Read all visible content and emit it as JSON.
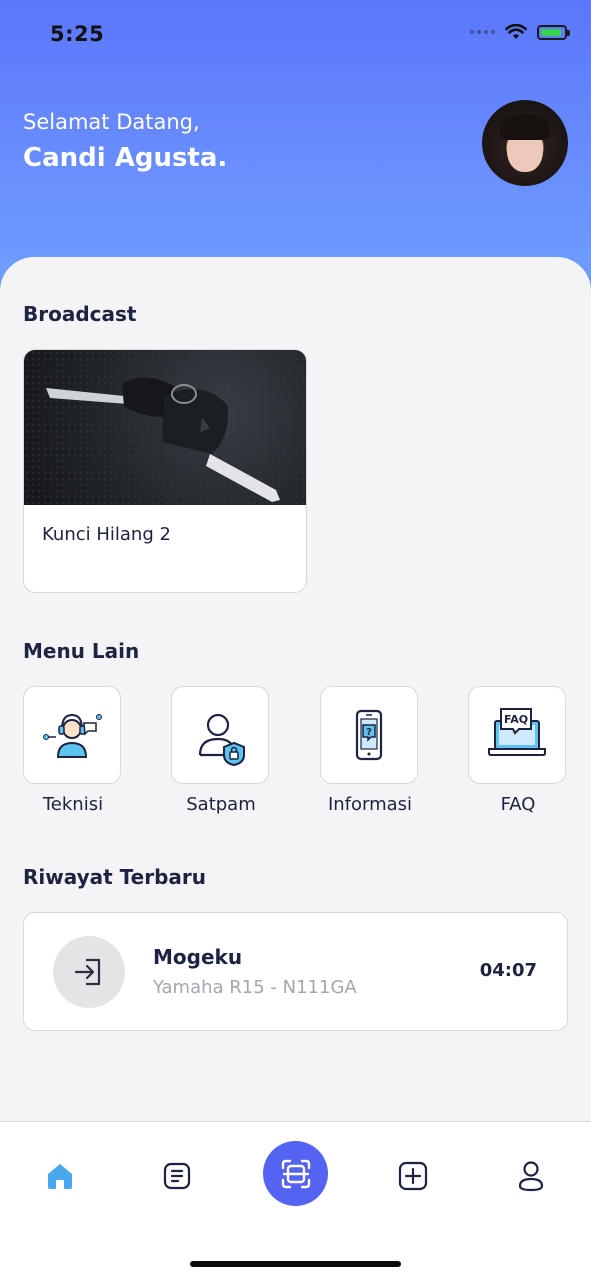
{
  "status_bar": {
    "time": "5:25"
  },
  "header": {
    "greeting": "Selamat Datang,",
    "user_name": "Candi Agusta."
  },
  "broadcast": {
    "title": "Broadcast",
    "items": [
      {
        "title": "Kunci Hilang 2"
      }
    ]
  },
  "menu_lain": {
    "title": "Menu Lain",
    "items": [
      {
        "label": "Teknisi",
        "icon": "technician-icon"
      },
      {
        "label": "Satpam",
        "icon": "security-guard-icon"
      },
      {
        "label": "Informasi",
        "icon": "phone-info-icon"
      },
      {
        "label": "FAQ",
        "icon": "faq-laptop-icon"
      }
    ]
  },
  "riwayat": {
    "title": "Riwayat Terbaru",
    "items": [
      {
        "title": "Mogeku",
        "subtitle": "Yamaha R15 - N111GA",
        "time": "04:07",
        "icon": "login-icon"
      }
    ]
  },
  "nav": {
    "items": [
      {
        "icon": "home-icon",
        "active": true
      },
      {
        "icon": "list-icon"
      },
      {
        "icon": "scan-icon"
      },
      {
        "icon": "add-icon"
      },
      {
        "icon": "profile-icon"
      }
    ]
  },
  "colors": {
    "accent": "#5563f2",
    "hero_top": "#5b76fb",
    "hero_bottom": "#6fa3ff",
    "active_nav": "#4aa8ef"
  }
}
